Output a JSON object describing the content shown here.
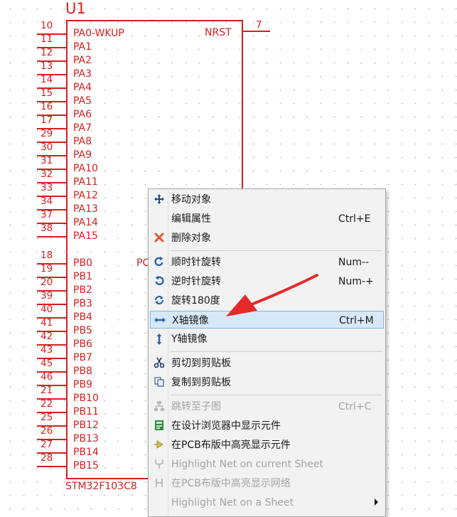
{
  "component": {
    "designator": "U1",
    "part_name": "STM32F103C8",
    "partial_pin_label": "PC",
    "left_pins": [
      {
        "num": "10",
        "name": "PA0-WKUP"
      },
      {
        "num": "11",
        "name": "PA1"
      },
      {
        "num": "12",
        "name": "PA2"
      },
      {
        "num": "13",
        "name": "PA3"
      },
      {
        "num": "14",
        "name": "PA4"
      },
      {
        "num": "15",
        "name": "PA5"
      },
      {
        "num": "16",
        "name": "PA6"
      },
      {
        "num": "17",
        "name": "PA7"
      },
      {
        "num": "29",
        "name": "PA8"
      },
      {
        "num": "30",
        "name": "PA9"
      },
      {
        "num": "31",
        "name": "PA10"
      },
      {
        "num": "32",
        "name": "PA11"
      },
      {
        "num": "33",
        "name": "PA12"
      },
      {
        "num": "34",
        "name": "PA13"
      },
      {
        "num": "37",
        "name": "PA14"
      },
      {
        "num": "38",
        "name": "PA15"
      },
      {
        "num": "18",
        "name": "PB0"
      },
      {
        "num": "19",
        "name": "PB1"
      },
      {
        "num": "20",
        "name": "PB2"
      },
      {
        "num": "39",
        "name": "PB3"
      },
      {
        "num": "40",
        "name": "PB4"
      },
      {
        "num": "41",
        "name": "PB5"
      },
      {
        "num": "42",
        "name": "PB6"
      },
      {
        "num": "43",
        "name": "PB7"
      },
      {
        "num": "45",
        "name": "PB8"
      },
      {
        "num": "46",
        "name": "PB9"
      },
      {
        "num": "21",
        "name": "PB10"
      },
      {
        "num": "22",
        "name": "PB11"
      },
      {
        "num": "25",
        "name": "PB12"
      },
      {
        "num": "26",
        "name": "PB13"
      },
      {
        "num": "27",
        "name": "PB14"
      },
      {
        "num": "28",
        "name": "PB15"
      }
    ],
    "right_pin": {
      "num": "7",
      "name": "NRST"
    }
  },
  "context_menu": {
    "items": [
      {
        "icon": "move-icon",
        "label": "移动对象",
        "shortcut": "",
        "disabled": false
      },
      {
        "icon": "",
        "label": "编辑属性",
        "shortcut": "Ctrl+E",
        "disabled": false
      },
      {
        "icon": "delete-icon",
        "label": "删除对象",
        "shortcut": "",
        "disabled": false,
        "separator_after": true
      },
      {
        "icon": "rotate-cw-icon",
        "label": "顺时针旋转",
        "shortcut": "Num--",
        "disabled": false
      },
      {
        "icon": "rotate-ccw-icon",
        "label": "逆时针旋转",
        "shortcut": "Num-+",
        "disabled": false
      },
      {
        "icon": "rotate-180-icon",
        "label": "旋转180度",
        "shortcut": "",
        "disabled": false
      },
      {
        "icon": "mirror-x-icon",
        "label": "X轴镜像",
        "shortcut": "Ctrl+M",
        "disabled": false,
        "highlighted": true
      },
      {
        "icon": "mirror-y-icon",
        "label": "Y轴镜像",
        "shortcut": "",
        "disabled": false,
        "separator_after": true
      },
      {
        "icon": "cut-icon",
        "label": "剪切到剪贴板",
        "shortcut": "",
        "disabled": false
      },
      {
        "icon": "copy-icon",
        "label": "复制到剪贴板",
        "shortcut": "",
        "disabled": false,
        "separator_after": true
      },
      {
        "icon": "hierarchy-icon",
        "label": "跳转至子图",
        "shortcut": "Ctrl+C",
        "disabled": true
      },
      {
        "icon": "browser-icon",
        "label": "在设计浏览器中显示元件",
        "shortcut": "",
        "disabled": false
      },
      {
        "icon": "pcb-highlight-icon",
        "label": "在PCB布版中高亮显示元件",
        "shortcut": "",
        "disabled": false
      },
      {
        "icon": "net-highlight-icon",
        "label": "Highlight Net on current Sheet",
        "shortcut": "",
        "disabled": true
      },
      {
        "icon": "pcb-net-icon",
        "label": "在PCB布版中高亮显示网络",
        "shortcut": "",
        "disabled": true
      },
      {
        "icon": "",
        "label": "Highlight Net on a Sheet",
        "shortcut": "",
        "disabled": true,
        "submenu": true
      }
    ]
  },
  "colors": {
    "schematic_red": "#d42020",
    "callout_arrow": "#e8292c",
    "menu_bg": "#f2f2f2",
    "highlight_bg": "#d7e8f8"
  }
}
